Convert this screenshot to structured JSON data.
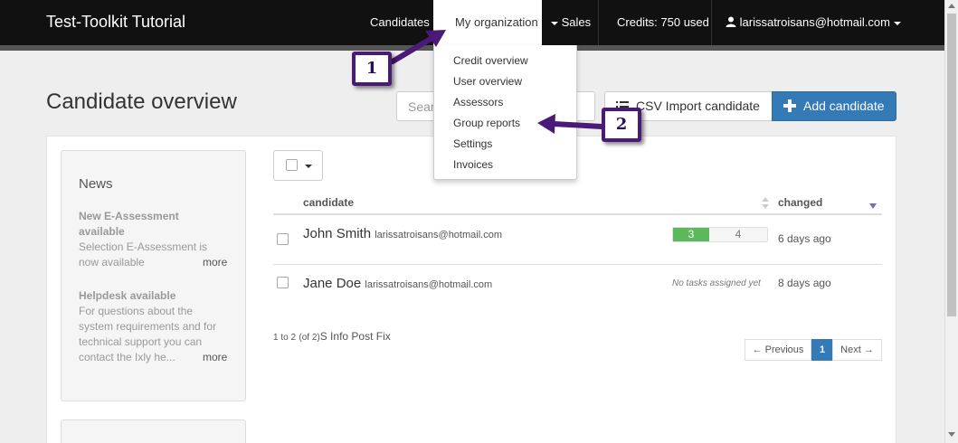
{
  "navbar": {
    "brand": "Test-Toolkit Tutorial",
    "items": [
      {
        "label": "Candidates"
      },
      {
        "label": "My organization"
      },
      {
        "label": "Sales"
      },
      {
        "label": "Credits: 750 used"
      },
      {
        "label": "larissatroisans@hotmail.com"
      }
    ]
  },
  "org_menu": {
    "items": [
      "Credit overview",
      "User overview",
      "Assessors",
      "Group reports",
      "Settings",
      "Invoices"
    ]
  },
  "page": {
    "title": "Candidate overview",
    "search_placeholder": "Search",
    "import_label": "CSV Import candidate",
    "add_label": "Add candidate"
  },
  "news": {
    "title": "News",
    "items": [
      {
        "headline": "New E-Assessment available",
        "text": "Selection E-Assessment is now available",
        "more": "more"
      },
      {
        "headline": "Helpdesk available",
        "text": "For questions about the system requirements and for technical support you can contact the Ixly he...",
        "more": "more"
      }
    ]
  },
  "table": {
    "headers": {
      "candidate": "candidate",
      "changed": "changed"
    },
    "rows": [
      {
        "name": "John Smith",
        "email": "larissatroisans@hotmail.com",
        "tasks_done": "3",
        "tasks_open": "4",
        "changed": "6 days ago"
      },
      {
        "name": "Jane Doe",
        "email": "larissatroisans@hotmail.com",
        "no_tasks": "No tasks assigned yet",
        "changed": "8 days ago"
      }
    ],
    "info_range": "1 to 2",
    "info_total": "(of 2)",
    "info_suffix": "S Info Post Fix"
  },
  "pagination": {
    "previous": "← Previous",
    "current": "1",
    "next": "Next →"
  },
  "callouts": {
    "first": "1",
    "second": "2"
  },
  "colors": {
    "navbar": "#111111",
    "primary": "#337ab7",
    "success": "#5cb85c",
    "callout": "#4b1a78"
  }
}
